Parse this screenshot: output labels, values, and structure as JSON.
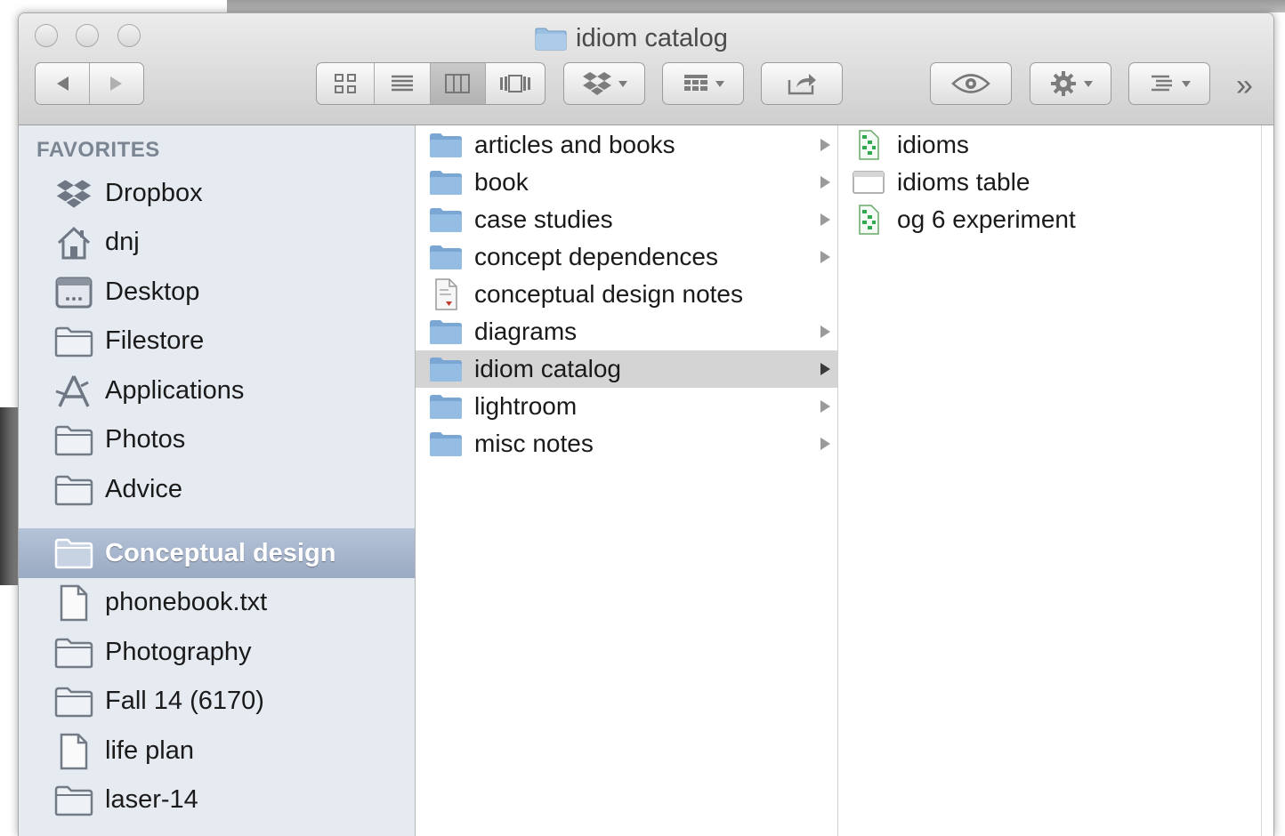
{
  "window": {
    "title": "idiom catalog"
  },
  "toolbar": {
    "back_icon": "back-arrow-icon",
    "forward_icon": "forward-arrow-icon",
    "view_modes": [
      "icon-view",
      "list-view",
      "column-view",
      "cover-flow-view"
    ],
    "active_view": "column-view",
    "overflow": "»"
  },
  "sidebar": {
    "heading": "FAVORITES",
    "items": [
      {
        "label": "Dropbox",
        "icon": "dropbox-icon"
      },
      {
        "label": "dnj",
        "icon": "home-icon"
      },
      {
        "label": "Desktop",
        "icon": "desktop-icon"
      },
      {
        "label": "Filestore",
        "icon": "folder-icon"
      },
      {
        "label": "Applications",
        "icon": "applications-icon"
      },
      {
        "label": "Photos",
        "icon": "folder-icon"
      },
      {
        "label": "Advice",
        "icon": "folder-icon"
      },
      {
        "label": "Conceptual design",
        "icon": "folder-icon",
        "selected": true
      },
      {
        "label": "phonebook.txt",
        "icon": "document-icon"
      },
      {
        "label": "Photography",
        "icon": "folder-icon"
      },
      {
        "label": "Fall 14 (6170)",
        "icon": "folder-icon"
      },
      {
        "label": "life plan",
        "icon": "document-icon"
      },
      {
        "label": "laser-14",
        "icon": "folder-icon"
      }
    ]
  },
  "column1": {
    "items": [
      {
        "label": "articles and books",
        "icon": "folder-icon",
        "has_children": true
      },
      {
        "label": "book",
        "icon": "folder-icon",
        "has_children": true
      },
      {
        "label": "case studies",
        "icon": "folder-icon",
        "has_children": true
      },
      {
        "label": "concept dependences",
        "icon": "folder-icon",
        "has_children": true
      },
      {
        "label": "conceptual design notes",
        "icon": "pdf-document-icon",
        "has_children": false
      },
      {
        "label": "diagrams",
        "icon": "folder-icon",
        "has_children": true
      },
      {
        "label": "idiom catalog",
        "icon": "folder-icon",
        "has_children": true,
        "selected": true
      },
      {
        "label": "lightroom",
        "icon": "folder-icon",
        "has_children": true
      },
      {
        "label": "misc notes",
        "icon": "folder-icon",
        "has_children": true
      }
    ]
  },
  "column2": {
    "items": [
      {
        "label": "idioms",
        "icon": "spreadsheet-icon"
      },
      {
        "label": "idioms table",
        "icon": "window-document-icon"
      },
      {
        "label": "og 6 experiment",
        "icon": "spreadsheet-icon"
      }
    ]
  },
  "colors": {
    "sidebar_bg": "#e6ebf2",
    "sidebar_selected": "#a6b5cc",
    "folder_blue": "#8db3d8",
    "row_selected": "#d4d4d4"
  }
}
